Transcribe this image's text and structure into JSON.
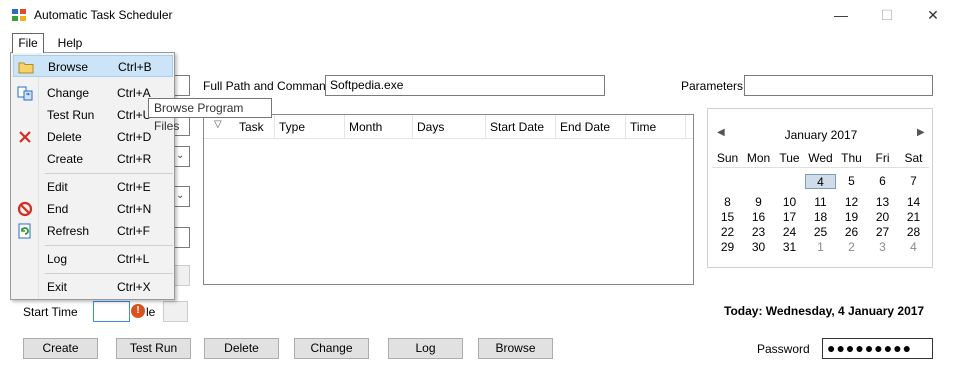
{
  "window": {
    "title": "Automatic Task Scheduler",
    "minimize_glyph": "—",
    "maximize_glyph": "☐",
    "close_glyph": "✕"
  },
  "menubar": {
    "file": "File",
    "help": "Help"
  },
  "file_menu": {
    "items": [
      {
        "label": "Browse",
        "shortcut": "Ctrl+B",
        "icon": "folder-icon"
      },
      {
        "label": "Change",
        "shortcut": "Ctrl+A",
        "icon": "change-icon"
      },
      {
        "label": "Test Run",
        "shortcut": "Ctrl+U",
        "icon": ""
      },
      {
        "label": "Delete",
        "shortcut": "Ctrl+D",
        "icon": "delete-x-icon"
      },
      {
        "label": "Create",
        "shortcut": "Ctrl+R",
        "icon": ""
      },
      {
        "label": "Edit",
        "shortcut": "Ctrl+E",
        "icon": ""
      },
      {
        "label": "End",
        "shortcut": "Ctrl+N",
        "icon": "stop-icon"
      },
      {
        "label": "Refresh",
        "shortcut": "Ctrl+F",
        "icon": "refresh-icon"
      },
      {
        "label": "Log",
        "shortcut": "Ctrl+L",
        "icon": ""
      },
      {
        "label": "Exit",
        "shortcut": "Ctrl+X",
        "icon": ""
      }
    ]
  },
  "tooltip": "Browse Program Files",
  "form": {
    "full_path_label": "Full Path and Command",
    "full_path_value": "Softpedia.exe",
    "parameters_label": "Parameters",
    "parameters_value": "",
    "start_time_label": "Start Time",
    "partial_label": "le"
  },
  "task_list": {
    "columns": [
      "Task",
      "Type",
      "Month",
      "Days",
      "Start Date",
      "End Date",
      "Time"
    ],
    "rows": []
  },
  "calendar": {
    "prev_glyph": "◀",
    "next_glyph": "▶",
    "title": "January 2017",
    "days_of_week": [
      "Sun",
      "Mon",
      "Tue",
      "Wed",
      "Thu",
      "Fri",
      "Sat"
    ],
    "weeks": [
      [
        "",
        "",
        "",
        "4",
        "5",
        "6",
        "7"
      ],
      [
        "8",
        "9",
        "10",
        "11",
        "12",
        "13",
        "14"
      ],
      [
        "15",
        "16",
        "17",
        "18",
        "19",
        "20",
        "21"
      ],
      [
        "22",
        "23",
        "24",
        "25",
        "26",
        "27",
        "28"
      ],
      [
        "29",
        "30",
        "31",
        "1",
        "2",
        "3",
        "4"
      ]
    ],
    "today": "4"
  },
  "today_text": "Today: Wednesday, 4 January 2017",
  "buttons": {
    "create": "Create",
    "test_run": "Test Run",
    "delete": "Delete",
    "change": "Change",
    "log": "Log",
    "browse": "Browse"
  },
  "password": {
    "label": "Password",
    "value": "●●●●●●●●●"
  },
  "error_icon_glyph": "!"
}
